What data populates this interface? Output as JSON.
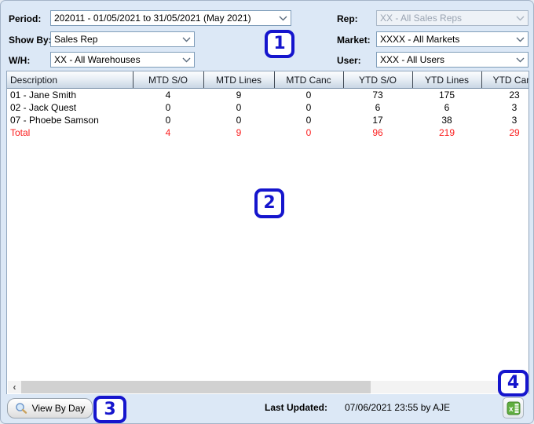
{
  "filters": {
    "period": {
      "label": "Period:",
      "value": "202011 - 01/05/2021 to 31/05/2021 (May 2021)"
    },
    "show_by": {
      "label": "Show By:",
      "value": "Sales Rep"
    },
    "warehouse": {
      "label": "W/H:",
      "value": "XX - All Warehouses"
    },
    "rep": {
      "label": "Rep:",
      "value": "XX - All Sales Reps",
      "disabled": true
    },
    "market": {
      "label": "Market:",
      "value": "XXXX - All Markets"
    },
    "user": {
      "label": "User:",
      "value": "XXX - All Users"
    }
  },
  "table": {
    "columns": [
      "Description",
      "MTD S/O",
      "MTD Lines",
      "MTD Canc",
      "YTD S/O",
      "YTD Lines",
      "YTD Canc"
    ],
    "rows": [
      {
        "description": "01 - Jane Smith",
        "values": [
          "4",
          "9",
          "0",
          "73",
          "175",
          "23"
        ]
      },
      {
        "description": "02 - Jack Quest",
        "values": [
          "0",
          "0",
          "0",
          "6",
          "6",
          "3"
        ]
      },
      {
        "description": "07 - Phoebe Samson",
        "values": [
          "0",
          "0",
          "0",
          "17",
          "38",
          "3"
        ]
      }
    ],
    "total": {
      "description": "Total",
      "values": [
        "4",
        "9",
        "0",
        "96",
        "219",
        "29"
      ]
    }
  },
  "footer": {
    "view_by_day_label": "View By Day",
    "last_updated_label": "Last Updated:",
    "last_updated_value": "07/06/2021 23:55 by AJE"
  },
  "annotations": {
    "marker1": "1",
    "marker2": "2",
    "marker3": "3",
    "marker4": "4"
  },
  "icons": {
    "dropdown": "chevron-down-icon",
    "view_by_day": "magnifier-icon",
    "export": "excel-export-icon",
    "scroll_left": "scroll-left-arrow-icon",
    "scroll_right": "scroll-right-arrow-icon"
  },
  "colors": {
    "annotation_blue": "#1515cd",
    "total_red": "#fb2020",
    "panel_bg": "#dce8f6",
    "header_gradient_bottom": "#c9d6e4",
    "excel_green": "#5fae3f"
  }
}
